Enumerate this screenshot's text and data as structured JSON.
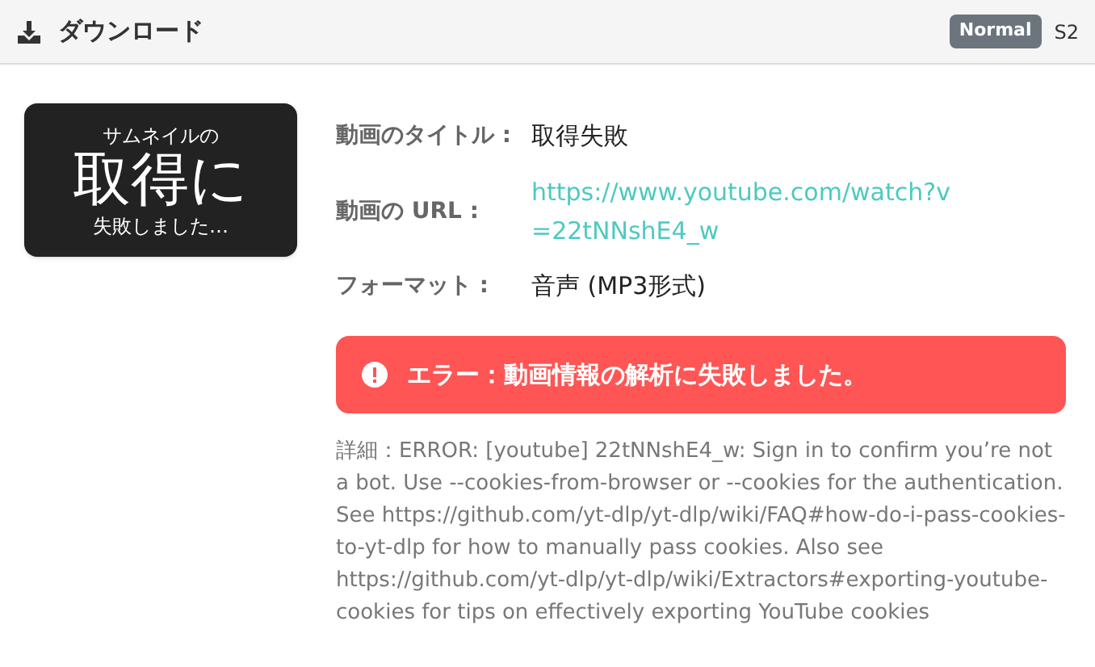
{
  "header": {
    "title": "ダウンロード",
    "badge": "Normal",
    "code": "S2"
  },
  "thumbnail": {
    "line_1": "サムネイルの",
    "line_2": "取得に",
    "line_3": "失敗しました…"
  },
  "fields": [
    {
      "label": "動画のタイトル :",
      "value": "取得失敗",
      "kind": "text"
    },
    {
      "label": "動画の URL :",
      "value": "https://www.youtube.com/watch?v=22tNNshE4_w",
      "kind": "link"
    },
    {
      "label": "フォーマット :",
      "value": "音声 (MP3形式)",
      "kind": "text"
    }
  ],
  "error": {
    "message": "エラー：動画情報の解析に失敗しました。"
  },
  "detail": "詳細：ERROR: [youtube] 22tNNshE4_w: Sign in to confirm you’re not a bot. Use --cookies-from-browser or --cookies for the authentication. See https://github.com/yt-dlp/yt-dlp/wiki/FAQ#how-do-i-pass-cookies-to-yt-dlp for how to manually pass cookies. Also see https://github.com/yt-dlp/yt-dlp/wiki/Extractors#exporting-youtube-cookies for tips on effectively exporting YouTube cookies"
}
